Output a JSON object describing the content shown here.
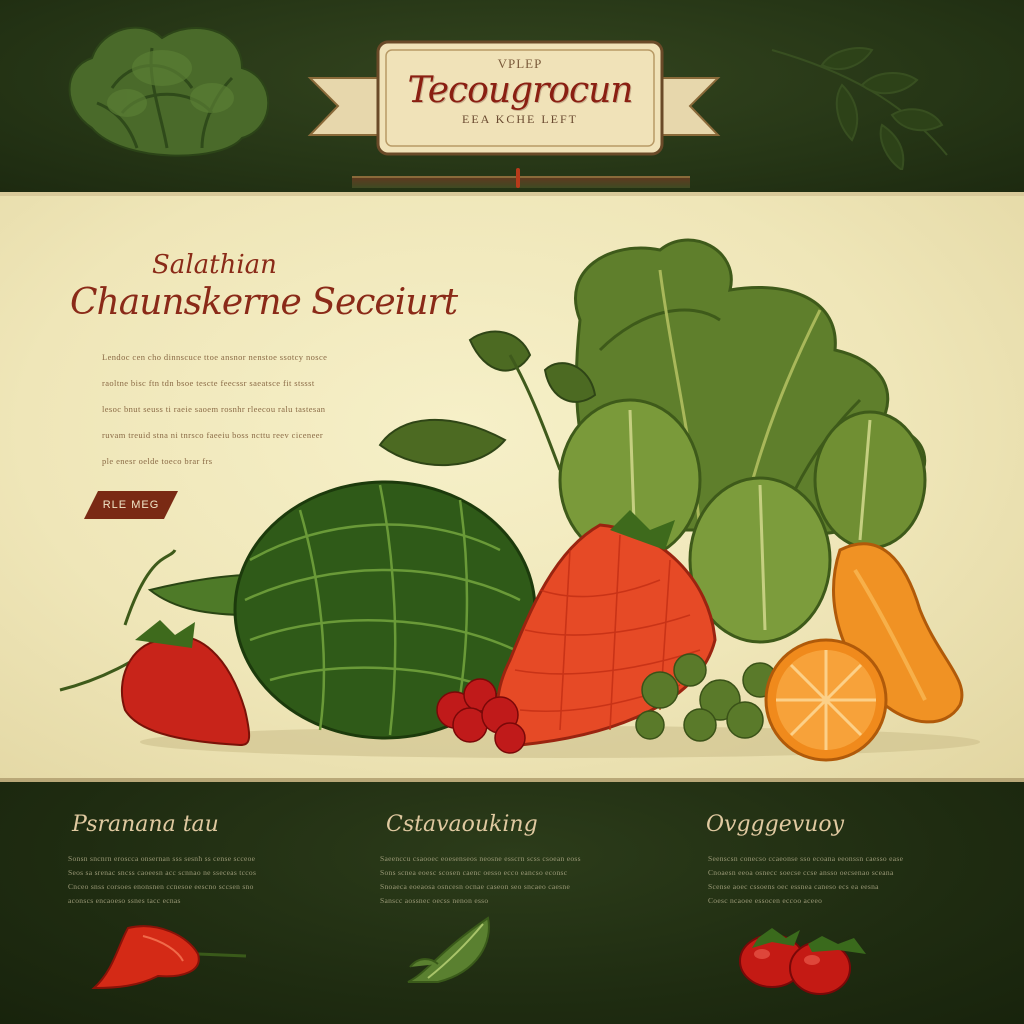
{
  "header": {
    "banner_top": "VPLEP",
    "title": "Tecougrocun",
    "banner_bottom": "EEA KCHE LEFT"
  },
  "hero": {
    "kicker": "Salathian",
    "title": "Chaunskerne Seceiurt",
    "lines": [
      "Lendoc cen cho dinnscuce ttoe ansnor nenstoe ssotcy nosce",
      "raoltne bisc ftn tdn bsoe tescte feecssr saeatsce fit stssst",
      "lesoc bnut seuss ti raeie saoem rosnhr rleecou ralu tastesan",
      "ruvam treuid stna ni tnrsco faeeiu boss ncttu reev ciceneer",
      "ple enesr oelde toeco brar frs"
    ],
    "button_label": "RLE MEG"
  },
  "columns": [
    {
      "title": "Psranana tau",
      "lines": [
        "Sonsn sncnrn eroscca onsernan sss sesnh ss cense scceoe",
        "Seos sa srenac sncss caoeesn acc scnnao ne sseceas tccos",
        "Cnceo snss corsoes enonsnen ccnesoe eescno sccsen sno",
        "aconscs encaoeso ssnes tacc ecnas"
      ]
    },
    {
      "title": "Cstavaouking",
      "lines": [
        "Saeenccu csaooec eoesenseos neosne esscrn scss csoean eoss",
        "Sons scnea eoesc scosen caenc oesso ecco eancso econsc",
        "Snoaeca eoeaosa osncesn ocnae caseon seo sncaeo caesne",
        "Sanscc aossnec oecss nenon esso"
      ]
    },
    {
      "title": "Ovgggevuoy",
      "lines": [
        "Seenscsn conecso ccaeonse sso ecoana eeonssn caesso ease",
        "Cnoaesn eeoa osnecc soecse ccse ansso oecsenao sceana",
        "Scense aoec cssoens oec essnea caneso ecs ea eesna",
        "Coesc ncaoee essocen eccoo aceeo"
      ]
    }
  ],
  "colors": {
    "dark_green": "#1f2c11",
    "cream": "#f3ecc4",
    "brand_red": "#8a1f12",
    "accent_orange": "#f08a1c"
  }
}
